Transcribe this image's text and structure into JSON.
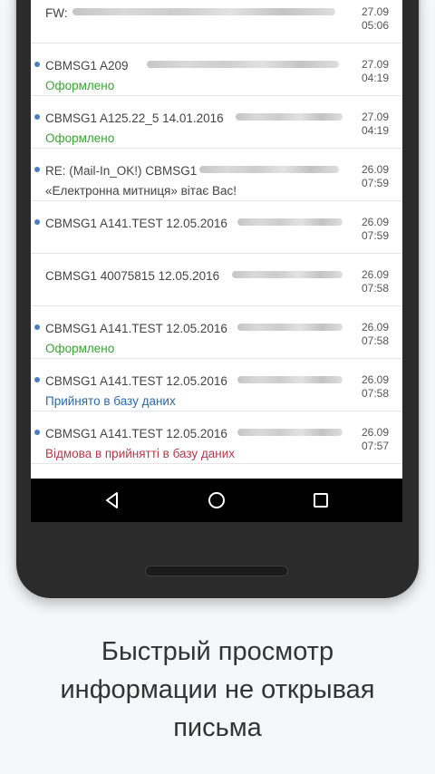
{
  "messages": [
    {
      "unread": false,
      "subject": "FW:",
      "status": "",
      "status_color": "",
      "date": "27.09",
      "time": "05:06"
    },
    {
      "unread": true,
      "subject": "CBMSG1 A209",
      "status": "Оформлено",
      "status_color": "green",
      "date": "27.09",
      "time": "04:19"
    },
    {
      "unread": true,
      "subject": "CBMSG1 A125.22_5 14.01.2016",
      "status": "Оформлено",
      "status_color": "green",
      "date": "27.09",
      "time": "04:19"
    },
    {
      "unread": true,
      "subject": "RE: (Mail-In_OK!) CBMSG1",
      "status": "«Електронна митниця» вітає Вас!",
      "status_color": "gray",
      "date": "26.09",
      "time": "07:59"
    },
    {
      "unread": true,
      "subject": "CBMSG1 A141.TEST 12.05.2016",
      "status": "",
      "status_color": "",
      "date": "26.09",
      "time": "07:59"
    },
    {
      "unread": false,
      "subject": "CBMSG1 40075815 12.05.2016",
      "status": "",
      "status_color": "",
      "date": "26.09",
      "time": "07:58"
    },
    {
      "unread": true,
      "subject": "CBMSG1 A141.TEST 12.05.2016",
      "status": "Оформлено",
      "status_color": "green",
      "date": "26.09",
      "time": "07:58"
    },
    {
      "unread": true,
      "subject": "CBMSG1 A141.TEST 12.05.2016",
      "status": "Прийнято в базу даних",
      "status_color": "blue",
      "date": "26.09",
      "time": "07:58"
    },
    {
      "unread": true,
      "subject": "CBMSG1 A141.TEST 12.05.2016",
      "status": "Відмова в прийнятті в базу даних",
      "status_color": "red",
      "date": "26.09",
      "time": "07:57"
    }
  ],
  "caption": {
    "line1": "Быстрый просмотр",
    "line2": "информации не открывая",
    "line3": "письма"
  },
  "colors": {
    "green": "#3fa23a",
    "blue": "#2d6aa6",
    "red": "#b03a4b",
    "unread_dot": "#4a7fc1"
  },
  "nav_icons": [
    "back-icon",
    "home-icon",
    "recents-icon"
  ]
}
